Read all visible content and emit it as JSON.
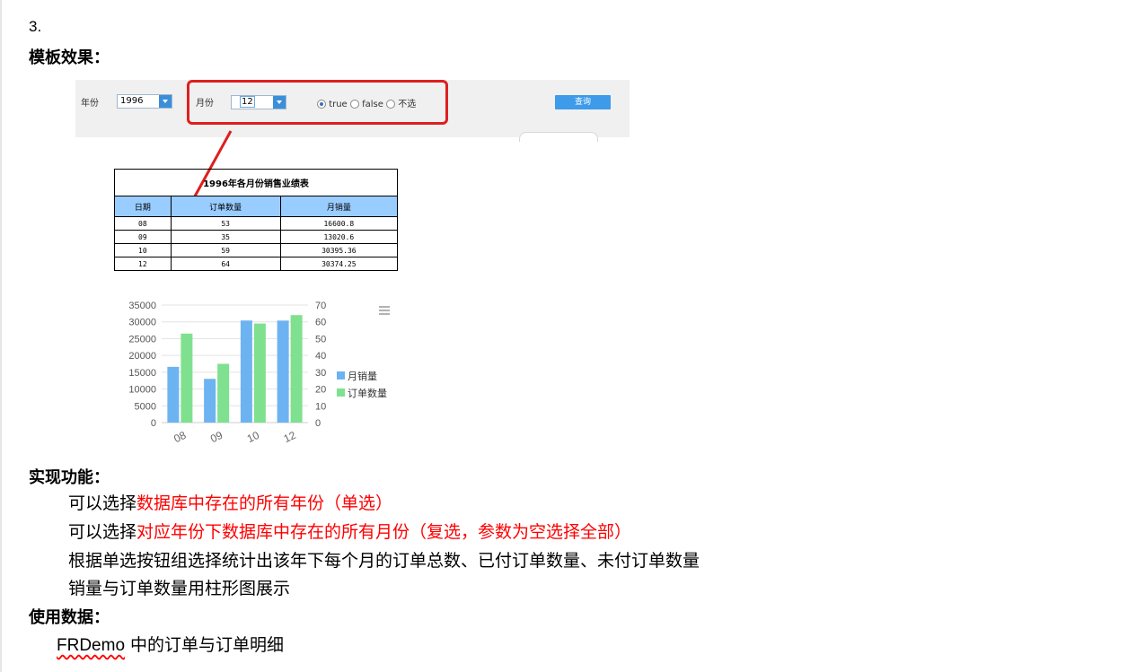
{
  "section_number": "3.",
  "headings": {
    "template_effect": "模板效果：",
    "features": "实现功能：",
    "data_used": "使用数据："
  },
  "toolbar": {
    "year_label": "年份",
    "year_value": "1996",
    "month_label": "月份",
    "month_value": "12",
    "radio_options": [
      "true",
      "false",
      "不选"
    ],
    "radio_selected": "true",
    "query_label": "查询"
  },
  "report": {
    "title": "1996年各月份销售业绩表",
    "columns": [
      "日期",
      "订单数量",
      "月销量"
    ],
    "rows": [
      [
        "08",
        "53",
        "16600.8"
      ],
      [
        "09",
        "35",
        "13020.6"
      ],
      [
        "10",
        "59",
        "30395.36"
      ],
      [
        "12",
        "64",
        "30374.25"
      ]
    ]
  },
  "chart_data": {
    "type": "bar",
    "categories": [
      "08",
      "09",
      "10",
      "12"
    ],
    "series": [
      {
        "name": "月销量",
        "values": [
          16600.8,
          13020.6,
          30395.36,
          30374.25
        ],
        "axis": "left",
        "color": "#6db3f2"
      },
      {
        "name": "订单数量",
        "values": [
          53,
          35,
          59,
          64
        ],
        "axis": "right",
        "color": "#7fe08f"
      }
    ],
    "y_left_ticks": [
      "35000",
      "30000",
      "25000",
      "20000",
      "15000",
      "10000",
      "5000",
      "0"
    ],
    "y_right_ticks": [
      "70",
      "60",
      "50",
      "40",
      "30",
      "20",
      "10",
      "0"
    ],
    "ylim_left": [
      0,
      35000
    ],
    "ylim_right": [
      0,
      70
    ],
    "legend_position": "right",
    "grid": true
  },
  "features": {
    "line1_prefix": "可以选择",
    "line1_red": "数据库中存在的所有年份（单选）",
    "line2_prefix": "可以选择",
    "line2_red": "对应年份下数据库中存在的所有月份（复选，参数为空选择全部）",
    "line3": "根据单选按钮组选择统计出该年下每个月的订单总数、已付订单数量、未付订单数量",
    "line4": "销量与订单数量用柱形图展示"
  },
  "data_used": {
    "source_name": "FRDemo",
    "rest": " 中的订单与订单明细"
  },
  "colors": {
    "red_text": "#ff0000",
    "highlight_box": "#e01e1e",
    "table_header": "#99ccff",
    "query_button": "#3d9be9"
  }
}
